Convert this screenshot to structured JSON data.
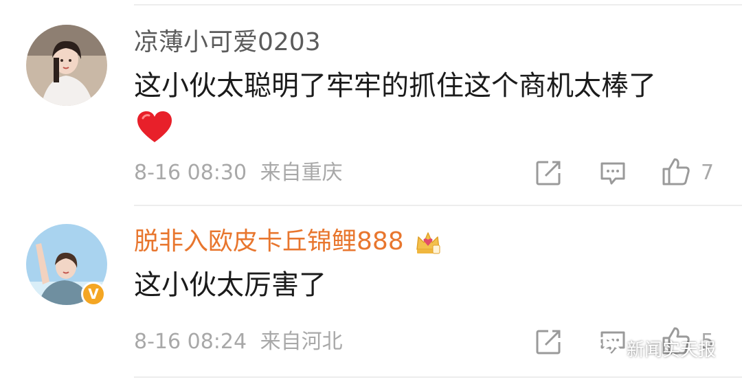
{
  "comments": [
    {
      "username": "凉薄小可爱0203",
      "text": "这小伙太聪明了牢牢的抓住这个商机太棒了",
      "emoji": "❤️",
      "time": "8-16 08:30",
      "location": "来自重庆",
      "like_count": "7",
      "username_color": "#5b5b5b"
    },
    {
      "username": "脱非入欧皮卡丘锦鲤888",
      "text": "这小伙太厉害了",
      "time": "8-16 08:24",
      "location": "来自河北",
      "like_count": "5",
      "username_color": "#e8762e",
      "badge": "crown-vip-icon",
      "verified": "V"
    }
  ],
  "watermark": {
    "text": "新闻实天报"
  },
  "colors": {
    "meta": "#a8a8a8",
    "text": "#1b1b1b",
    "vip_name": "#e8762e",
    "verified": "#f4a623"
  }
}
